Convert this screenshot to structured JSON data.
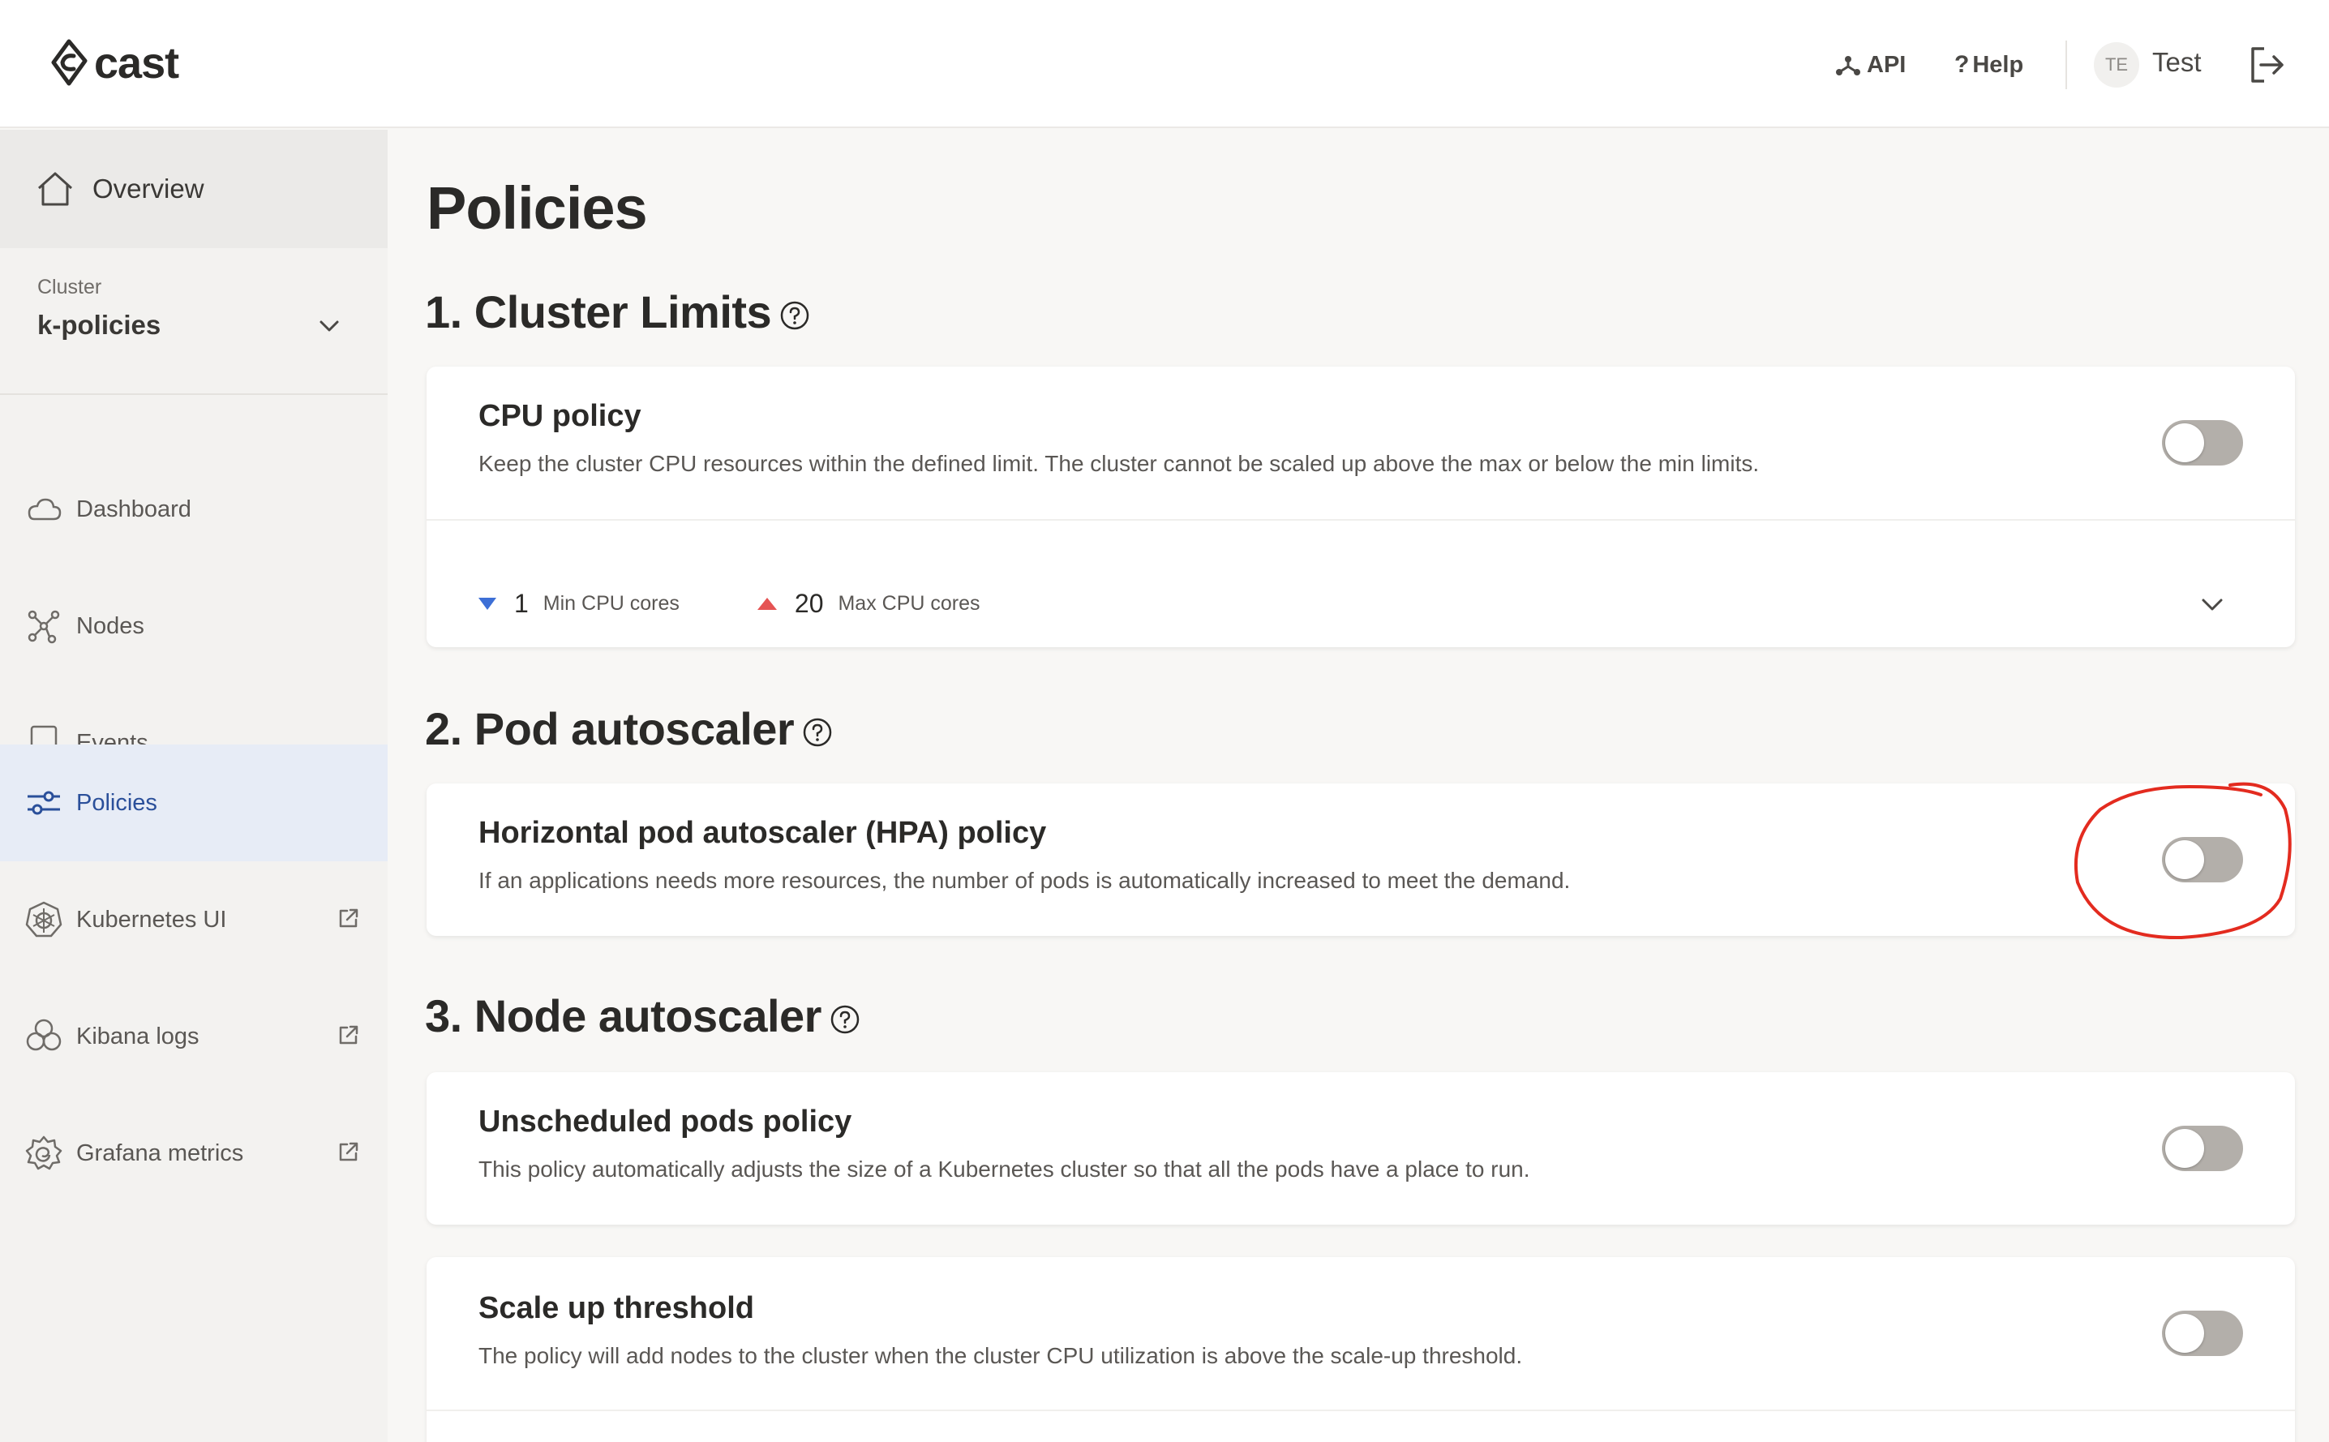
{
  "header": {
    "logo_text": "cast",
    "api_label": "API",
    "help_label": "Help",
    "avatar_initials": "TE",
    "user_name": "Test"
  },
  "sidebar": {
    "overview_label": "Overview",
    "cluster_caption": "Cluster",
    "cluster_name": "k-policies",
    "items": [
      {
        "label": "Dashboard",
        "icon": "cloud-icon"
      },
      {
        "label": "Nodes",
        "icon": "nodes-icon"
      },
      {
        "label": "Events",
        "icon": "book-icon"
      },
      {
        "label": "Policies",
        "icon": "sliders-icon",
        "active": true
      },
      {
        "label": "Kubernetes UI",
        "icon": "kubernetes-icon",
        "external": true
      },
      {
        "label": "Kibana logs",
        "icon": "kibana-icon",
        "external": true
      },
      {
        "label": "Grafana metrics",
        "icon": "grafana-icon",
        "external": true
      }
    ]
  },
  "main": {
    "page_title": "Policies",
    "sections": [
      {
        "title": "1. Cluster Limits",
        "cards": [
          {
            "title": "CPU policy",
            "description": "Keep the cluster CPU resources within the defined limit. The cluster cannot be scaled up above the max or below the min limits.",
            "enabled": false,
            "min_value": "1",
            "min_label": "Min CPU cores",
            "max_value": "20",
            "max_label": "Max CPU cores"
          }
        ]
      },
      {
        "title": "2. Pod autoscaler",
        "cards": [
          {
            "title": "Horizontal pod autoscaler (HPA) policy",
            "description": "If an applications needs more resources, the number of pods is automatically increased to meet the demand.",
            "enabled": false
          }
        ]
      },
      {
        "title": "3. Node autoscaler",
        "cards": [
          {
            "title": "Unscheduled pods policy",
            "description": "This policy automatically adjusts the size of a Kubernetes cluster so that all the pods have a place to run.",
            "enabled": false
          },
          {
            "title": "Scale up threshold",
            "description": "The policy will add nodes to the cluster when the cluster CPU utilization is above the scale-up threshold.",
            "enabled": false
          }
        ]
      }
    ]
  },
  "colors": {
    "accent_blue": "#2a4f9a",
    "min_arrow": "#3d6fd6",
    "max_arrow": "#e55353",
    "annotation_red": "#e32b1f",
    "toggle_off": "#b3afaa"
  }
}
